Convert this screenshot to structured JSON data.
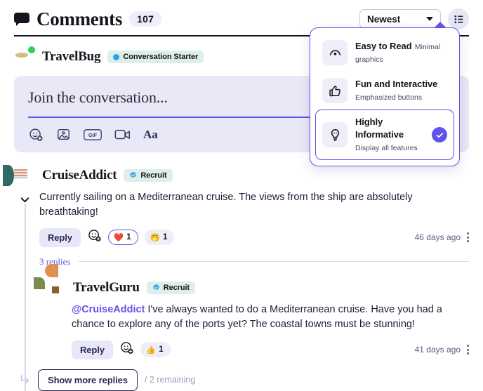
{
  "header": {
    "icon": "comment-bubble-icon",
    "title": "Comments",
    "count": "107",
    "sort": {
      "value": "Newest",
      "icon": "chevron-down-icon"
    },
    "view_button_icon": "list-settings-icon"
  },
  "view_menu": {
    "options": [
      {
        "title": "Easy to Read",
        "subtitle": "Minimal graphics",
        "icon": "eye-icon",
        "selected": false
      },
      {
        "title": "Fun and Interactive",
        "subtitle": "Emphasized buttons",
        "icon": "thumbs-up-icon",
        "selected": false
      },
      {
        "title": "Highly Informative",
        "subtitle": "Display all features",
        "icon": "lightbulb-icon",
        "selected": true
      }
    ]
  },
  "composer": {
    "user": {
      "name": "TravelBug",
      "avatar": "globe-avatar",
      "online": true
    },
    "badge": {
      "label": "Conversation Starter",
      "dot_color": "#2aa3e8"
    },
    "placeholder": "Join the conversation...",
    "tools": [
      {
        "name": "emoji-add-icon",
        "label": ""
      },
      {
        "name": "image-icon",
        "label": ""
      },
      {
        "name": "gif-icon",
        "label": "GIF"
      },
      {
        "name": "video-icon",
        "label": ""
      },
      {
        "name": "text-format-icon",
        "label": "Aa"
      }
    ]
  },
  "comment": {
    "user": {
      "name": "CruiseAddict",
      "avatar": "cruise-avatar"
    },
    "badge": {
      "label": "Recruit",
      "icon": "verified-icon"
    },
    "text": "Currently sailing on a Mediterranean cruise. The views from the ship are absolutely breathtaking!",
    "reply_label": "Reply",
    "add_reaction_icon": "emoji-add-icon",
    "reactions": [
      {
        "emoji": "❤️",
        "count": "1",
        "active": true
      },
      {
        "emoji": "🤭",
        "count": "1",
        "active": false
      }
    ],
    "timeago": "46 days ago",
    "menu_icon": "kebab-menu-icon",
    "replies_label": "3 replies"
  },
  "reply": {
    "user": {
      "name": "TravelGuru",
      "avatar": "guru-avatar"
    },
    "badge": {
      "label": "Recruit",
      "icon": "verified-icon"
    },
    "mention": "@CruiseAddict",
    "text": " I've always wanted to do a Mediterranean cruise. Have you had a chance to explore any of the ports yet? The coastal towns must be stunning!",
    "reply_label": "Reply",
    "add_reaction_icon": "emoji-add-icon",
    "reactions": [
      {
        "emoji": "👍",
        "count": "1",
        "active": false
      }
    ],
    "timeago": "41 days ago",
    "menu_icon": "kebab-menu-icon"
  },
  "show_more": {
    "icon": "corner-arrow-icon",
    "label": "Show more replies",
    "remaining": "/ 2 remaining"
  },
  "colors": {
    "accent": "#6253e8",
    "accent_soft": "#eeeefb",
    "composer_bg": "#e8e8f7",
    "badge_bg": "#dcefe9",
    "online": "#2ecc5a"
  }
}
